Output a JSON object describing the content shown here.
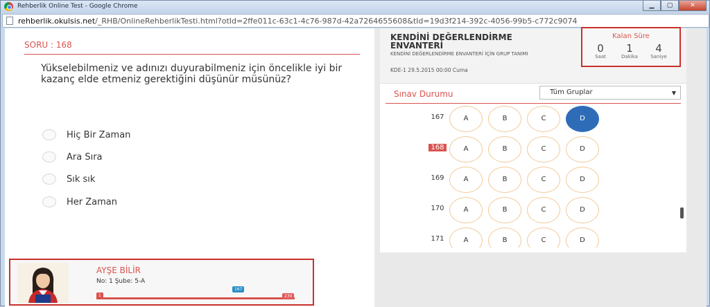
{
  "window": {
    "title": "Rehberlik Online Test - Google Chrome",
    "close_label": "✕"
  },
  "address": {
    "host": "rehberlik.okulsis.net",
    "path": "/_RHB/OnlineRehberlikTesti.html?otId=2ffe011c-63c1-4c76-987d-42a7264655608&tId=19d3f214-392c-4056-99b5-c772c9074"
  },
  "question": {
    "number_label": "SORU : 168",
    "text": "Yükselebilmeniz ve adınızı duyurabilmeniz için öncelikle iyi bir kazanç elde etmeniz gerektiğini düşünür müsünüz?",
    "options": [
      "Hiç Bir Zaman",
      "Ara Sıra",
      "Sık sık",
      "Her Zaman"
    ]
  },
  "inventory": {
    "title": "KENDİNİ DEĞERLENDİRME ENVANTERİ",
    "subtitle": "KENDİNİ DEĞERLENDİRME ENVANTERİ İÇİN GRUP TANIMI",
    "date_line": "KDE-1   29.5.2015 00:00 Cuma"
  },
  "timer": {
    "title": "Kalan Süre",
    "cells": [
      {
        "value": "0",
        "label": "Saat"
      },
      {
        "value": "1",
        "label": "Dakika"
      },
      {
        "value": "4",
        "label": "Saniye"
      }
    ]
  },
  "status": {
    "title": "Sınav Durumu",
    "group_select": "Tüm Gruplar",
    "rows": [
      {
        "num": "167",
        "current": false,
        "selected": "D"
      },
      {
        "num": "168",
        "current": true,
        "selected": null
      },
      {
        "num": "169",
        "current": false,
        "selected": null
      },
      {
        "num": "170",
        "current": false,
        "selected": null
      },
      {
        "num": "171",
        "current": false,
        "selected": null
      }
    ],
    "choices": [
      "A",
      "B",
      "C",
      "D"
    ],
    "scroll_fraction": 0.78
  },
  "profile": {
    "name": "AYŞE BİLİR",
    "info": "No: 1 Şube: 5-A",
    "progress_start": "1",
    "progress_current": "167",
    "progress_total": "230"
  },
  "colors": {
    "accent": "#d9534f",
    "selected": "#2f6cb8",
    "option_border": "#f2c998"
  }
}
